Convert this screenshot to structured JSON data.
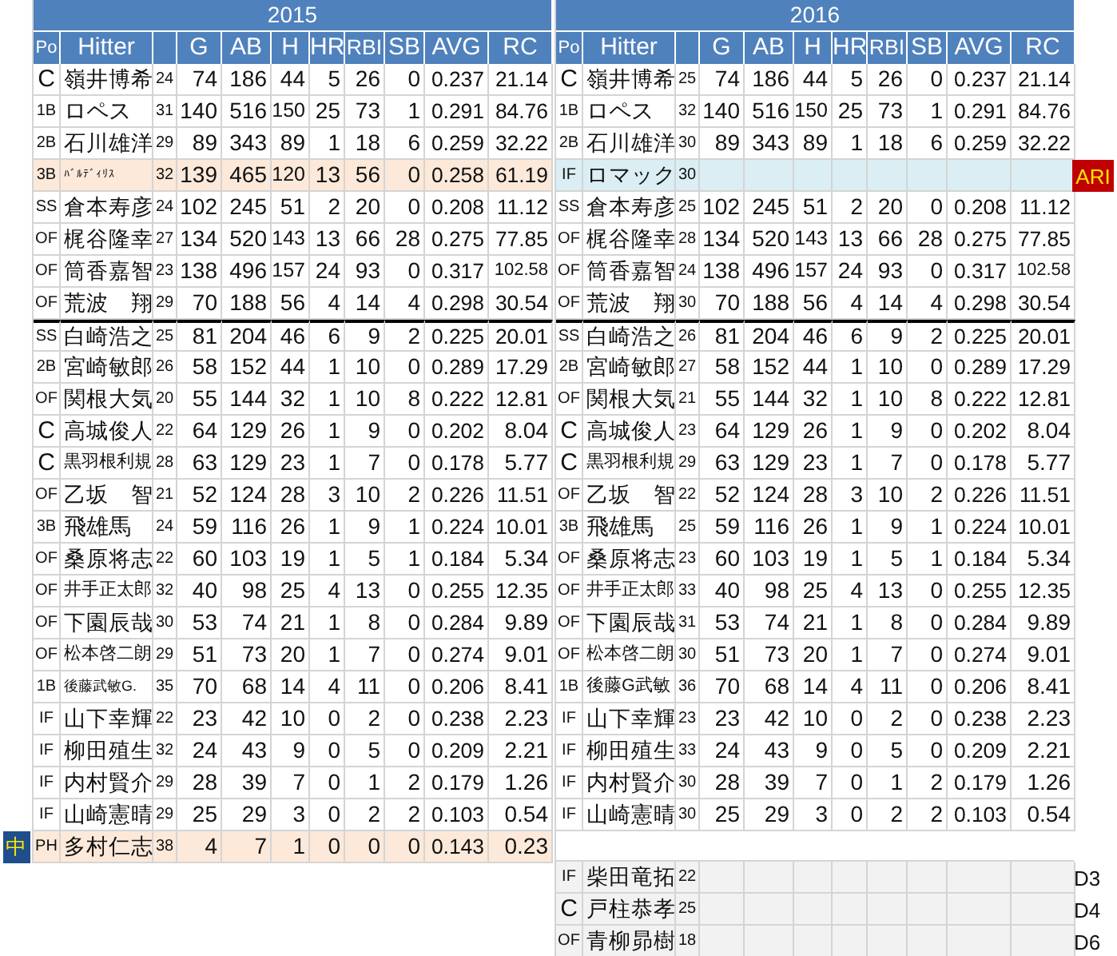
{
  "seasons": [
    {
      "year": "2015",
      "columns": [
        "Po",
        "Hitter",
        "G",
        "AB",
        "H",
        "HR",
        "RBI",
        "SB",
        "AVG",
        "RC"
      ],
      "lineup": [
        {
          "pos": "C",
          "name": "嶺井博希",
          "age": "24",
          "kind": "regular",
          "stats": [
            "74",
            "186",
            "44",
            "5",
            "26",
            "0",
            "0.237",
            "21.14"
          ]
        },
        {
          "pos": "1B",
          "name": "ロペス",
          "age": "31",
          "kind": "regular",
          "stats": [
            "140",
            "516",
            "150",
            "25",
            "73",
            "1",
            "0.291",
            "84.76"
          ]
        },
        {
          "pos": "2B",
          "name": "石川雄洋",
          "age": "29",
          "kind": "regular",
          "stats": [
            "89",
            "343",
            "89",
            "1",
            "18",
            "6",
            "0.259",
            "32.22"
          ]
        },
        {
          "pos": "3B",
          "name": "ﾊﾞﾙﾃﾞｨﾘｽ",
          "age": "32",
          "kind": "highlight",
          "stats": [
            "139",
            "465",
            "120",
            "13",
            "56",
            "0",
            "0.258",
            "61.19"
          ]
        },
        {
          "pos": "SS",
          "name": "倉本寿彦",
          "age": "24",
          "kind": "regular",
          "stats": [
            "102",
            "245",
            "51",
            "2",
            "20",
            "0",
            "0.208",
            "11.12"
          ]
        },
        {
          "pos": "OF",
          "name": "梶谷隆幸",
          "age": "27",
          "kind": "regular",
          "stats": [
            "134",
            "520",
            "143",
            "13",
            "66",
            "28",
            "0.275",
            "77.85"
          ]
        },
        {
          "pos": "OF",
          "name": "筒香嘉智",
          "age": "23",
          "kind": "regular",
          "stats": [
            "138",
            "496",
            "157",
            "24",
            "93",
            "0",
            "0.317",
            "102.58"
          ]
        },
        {
          "pos": "OF",
          "name": "荒波　翔",
          "age": "29",
          "kind": "regular",
          "stats": [
            "70",
            "188",
            "56",
            "4",
            "14",
            "4",
            "0.298",
            "30.54"
          ]
        }
      ],
      "bench": [
        {
          "pos": "SS",
          "name": "白崎浩之",
          "age": "25",
          "kind": "regular",
          "stats": [
            "81",
            "204",
            "46",
            "6",
            "9",
            "2",
            "0.225",
            "20.01"
          ]
        },
        {
          "pos": "2B",
          "name": "宮崎敏郎",
          "age": "26",
          "kind": "regular",
          "stats": [
            "58",
            "152",
            "44",
            "1",
            "10",
            "0",
            "0.289",
            "17.29"
          ]
        },
        {
          "pos": "OF",
          "name": "関根大気",
          "age": "20",
          "kind": "regular",
          "stats": [
            "55",
            "144",
            "32",
            "1",
            "10",
            "8",
            "0.222",
            "12.81"
          ]
        },
        {
          "pos": "C",
          "name": "高城俊人",
          "age": "22",
          "kind": "regular",
          "stats": [
            "64",
            "129",
            "26",
            "1",
            "9",
            "0",
            "0.202",
            "8.04"
          ]
        },
        {
          "pos": "C",
          "name": "黒羽根利規",
          "age": "28",
          "kind": "regular",
          "stats": [
            "63",
            "129",
            "23",
            "1",
            "7",
            "0",
            "0.178",
            "5.77"
          ]
        },
        {
          "pos": "OF",
          "name": "乙坂　智",
          "age": "21",
          "kind": "regular",
          "stats": [
            "52",
            "124",
            "28",
            "3",
            "10",
            "2",
            "0.226",
            "11.51"
          ]
        },
        {
          "pos": "3B",
          "name": "飛雄馬",
          "age": "24",
          "kind": "regular",
          "stats": [
            "59",
            "116",
            "26",
            "1",
            "9",
            "1",
            "0.224",
            "10.01"
          ]
        },
        {
          "pos": "OF",
          "name": "桑原将志",
          "age": "22",
          "kind": "regular",
          "stats": [
            "60",
            "103",
            "19",
            "1",
            "5",
            "1",
            "0.184",
            "5.34"
          ]
        },
        {
          "pos": "OF",
          "name": "井手正太郎",
          "age": "32",
          "kind": "regular",
          "stats": [
            "40",
            "98",
            "25",
            "4",
            "13",
            "0",
            "0.255",
            "12.35"
          ]
        },
        {
          "pos": "OF",
          "name": "下園辰哉",
          "age": "30",
          "kind": "regular",
          "stats": [
            "53",
            "74",
            "21",
            "1",
            "8",
            "0",
            "0.284",
            "9.89"
          ]
        },
        {
          "pos": "OF",
          "name": "松本啓二朗",
          "age": "29",
          "kind": "regular",
          "stats": [
            "51",
            "73",
            "20",
            "1",
            "7",
            "0",
            "0.274",
            "9.01"
          ]
        },
        {
          "pos": "1B",
          "name": "後藤武敏G.",
          "age": "35",
          "kind": "regular",
          "stats": [
            "70",
            "68",
            "14",
            "4",
            "11",
            "0",
            "0.206",
            "8.41"
          ]
        },
        {
          "pos": "IF",
          "name": "山下幸輝",
          "age": "22",
          "kind": "regular",
          "stats": [
            "23",
            "42",
            "10",
            "0",
            "2",
            "0",
            "0.238",
            "2.23"
          ]
        },
        {
          "pos": "IF",
          "name": "柳田殖生",
          "age": "32",
          "kind": "regular",
          "stats": [
            "24",
            "43",
            "9",
            "0",
            "5",
            "0",
            "0.209",
            "2.21"
          ]
        },
        {
          "pos": "IF",
          "name": "内村賢介",
          "age": "29",
          "kind": "regular",
          "stats": [
            "28",
            "39",
            "7",
            "0",
            "1",
            "2",
            "0.179",
            "1.26"
          ]
        },
        {
          "pos": "IF",
          "name": "山崎憲晴",
          "age": "29",
          "kind": "regular",
          "stats": [
            "25",
            "29",
            "3",
            "0",
            "2",
            "2",
            "0.103",
            "0.54"
          ]
        },
        {
          "pos": "PH",
          "name": "多村仁志",
          "age": "38",
          "kind": "highlight",
          "tag": "中",
          "color": "#1f4e8c",
          "stats": [
            "4",
            "7",
            "1",
            "0",
            "0",
            "0",
            "0.143",
            "0.23"
          ]
        }
      ]
    },
    {
      "year": "2016",
      "columns": [
        "Po",
        "Hitter",
        "G",
        "AB",
        "H",
        "HR",
        "RBI",
        "SB",
        "AVG",
        "RC"
      ],
      "lineup": [
        {
          "pos": "C",
          "name": "嶺井博希",
          "age": "25",
          "kind": "regular",
          "stats": [
            "74",
            "186",
            "44",
            "5",
            "26",
            "0",
            "0.237",
            "21.14"
          ]
        },
        {
          "pos": "1B",
          "name": "ロペス",
          "age": "32",
          "kind": "regular",
          "stats": [
            "140",
            "516",
            "150",
            "25",
            "73",
            "1",
            "0.291",
            "84.76"
          ]
        },
        {
          "pos": "2B",
          "name": "石川雄洋",
          "age": "30",
          "kind": "regular",
          "stats": [
            "89",
            "343",
            "89",
            "1",
            "18",
            "6",
            "0.259",
            "32.22"
          ]
        },
        {
          "pos": "IF",
          "name": "ロマック",
          "age": "30",
          "kind": "newcomer",
          "tag": "ARI",
          "color": "#c00000"
        },
        {
          "pos": "SS",
          "name": "倉本寿彦",
          "age": "25",
          "kind": "regular",
          "stats": [
            "102",
            "245",
            "51",
            "2",
            "20",
            "0",
            "0.208",
            "11.12"
          ]
        },
        {
          "pos": "OF",
          "name": "梶谷隆幸",
          "age": "28",
          "kind": "regular",
          "stats": [
            "134",
            "520",
            "143",
            "13",
            "66",
            "28",
            "0.275",
            "77.85"
          ]
        },
        {
          "pos": "OF",
          "name": "筒香嘉智",
          "age": "24",
          "kind": "regular",
          "stats": [
            "138",
            "496",
            "157",
            "24",
            "93",
            "0",
            "0.317",
            "102.58"
          ]
        },
        {
          "pos": "OF",
          "name": "荒波　翔",
          "age": "30",
          "kind": "regular",
          "stats": [
            "70",
            "188",
            "56",
            "4",
            "14",
            "4",
            "0.298",
            "30.54"
          ]
        }
      ],
      "bench": [
        {
          "pos": "SS",
          "name": "白崎浩之",
          "age": "26",
          "kind": "regular",
          "stats": [
            "81",
            "204",
            "46",
            "6",
            "9",
            "2",
            "0.225",
            "20.01"
          ]
        },
        {
          "pos": "2B",
          "name": "宮崎敏郎",
          "age": "27",
          "kind": "regular",
          "stats": [
            "58",
            "152",
            "44",
            "1",
            "10",
            "0",
            "0.289",
            "17.29"
          ]
        },
        {
          "pos": "OF",
          "name": "関根大気",
          "age": "21",
          "kind": "regular",
          "stats": [
            "55",
            "144",
            "32",
            "1",
            "10",
            "8",
            "0.222",
            "12.81"
          ]
        },
        {
          "pos": "C",
          "name": "高城俊人",
          "age": "23",
          "kind": "regular",
          "stats": [
            "64",
            "129",
            "26",
            "1",
            "9",
            "0",
            "0.202",
            "8.04"
          ]
        },
        {
          "pos": "C",
          "name": "黒羽根利規",
          "age": "29",
          "kind": "regular",
          "stats": [
            "63",
            "129",
            "23",
            "1",
            "7",
            "0",
            "0.178",
            "5.77"
          ]
        },
        {
          "pos": "OF",
          "name": "乙坂　智",
          "age": "22",
          "kind": "regular",
          "stats": [
            "52",
            "124",
            "28",
            "3",
            "10",
            "2",
            "0.226",
            "11.51"
          ]
        },
        {
          "pos": "3B",
          "name": "飛雄馬",
          "age": "25",
          "kind": "regular",
          "stats": [
            "59",
            "116",
            "26",
            "1",
            "9",
            "1",
            "0.224",
            "10.01"
          ]
        },
        {
          "pos": "OF",
          "name": "桑原将志",
          "age": "23",
          "kind": "regular",
          "stats": [
            "60",
            "103",
            "19",
            "1",
            "5",
            "1",
            "0.184",
            "5.34"
          ]
        },
        {
          "pos": "OF",
          "name": "井手正太郎",
          "age": "33",
          "kind": "regular",
          "stats": [
            "40",
            "98",
            "25",
            "4",
            "13",
            "0",
            "0.255",
            "12.35"
          ]
        },
        {
          "pos": "OF",
          "name": "下園辰哉",
          "age": "31",
          "kind": "regular",
          "stats": [
            "53",
            "74",
            "21",
            "1",
            "8",
            "0",
            "0.284",
            "9.89"
          ]
        },
        {
          "pos": "OF",
          "name": "松本啓二朗",
          "age": "30",
          "kind": "regular",
          "stats": [
            "51",
            "73",
            "20",
            "1",
            "7",
            "0",
            "0.274",
            "9.01"
          ]
        },
        {
          "pos": "1B",
          "name": "後藤G武敏",
          "age": "36",
          "kind": "regular",
          "stats": [
            "70",
            "68",
            "14",
            "4",
            "11",
            "0",
            "0.206",
            "8.41"
          ]
        },
        {
          "pos": "IF",
          "name": "山下幸輝",
          "age": "23",
          "kind": "regular",
          "stats": [
            "23",
            "42",
            "10",
            "0",
            "2",
            "0",
            "0.238",
            "2.23"
          ]
        },
        {
          "pos": "IF",
          "name": "柳田殖生",
          "age": "33",
          "kind": "regular",
          "stats": [
            "24",
            "43",
            "9",
            "0",
            "5",
            "0",
            "0.209",
            "2.21"
          ]
        },
        {
          "pos": "IF",
          "name": "内村賢介",
          "age": "30",
          "kind": "regular",
          "stats": [
            "28",
            "39",
            "7",
            "0",
            "1",
            "2",
            "0.179",
            "1.26"
          ]
        },
        {
          "pos": "IF",
          "name": "山崎憲晴",
          "age": "30",
          "kind": "regular",
          "stats": [
            "25",
            "29",
            "3",
            "0",
            "2",
            "2",
            "0.103",
            "0.54"
          ]
        }
      ],
      "prospects": [
        {
          "pos": "IF",
          "name": "柴田竜拓",
          "age": "22",
          "note": "D3"
        },
        {
          "pos": "C",
          "name": "戸柱恭孝",
          "age": "25",
          "note": "D4"
        },
        {
          "pos": "OF",
          "name": "青柳昴樹",
          "age": "18",
          "note": "D6"
        }
      ]
    }
  ]
}
